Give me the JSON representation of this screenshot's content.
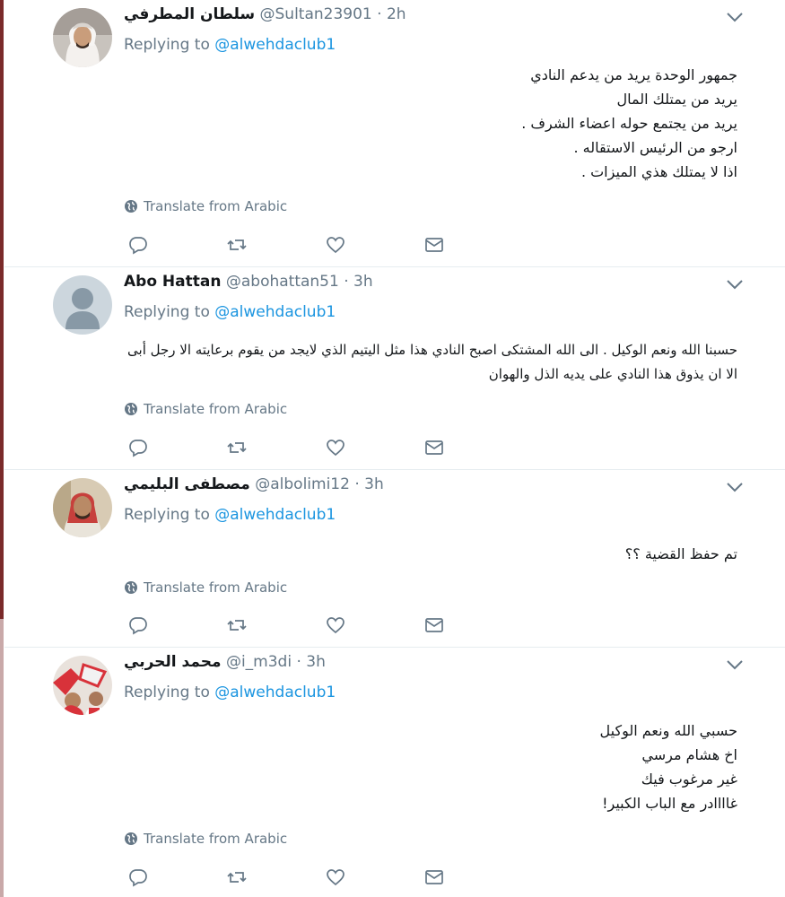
{
  "tweets": [
    {
      "name": "سلطان المطرفي",
      "handle": "@Sultan23901 · 2h",
      "replying_label": "Replying to",
      "replying_to": "@alwehdaclub1",
      "lines": [
        "جمهور الوحدة يريد من يدعم النادي",
        "يريد من يمتلك المال",
        "يريد من يجتمع حوله اعضاء الشرف .",
        "ارجو من الرئيس الاستقاله .",
        "اذا لا يمتلك هذي الميزات ."
      ],
      "translate": "Translate from Arabic"
    },
    {
      "name": "Abo Hattan",
      "handle": "@abohattan51 · 3h",
      "replying_label": "Replying to",
      "replying_to": "@alwehdaclub1",
      "lines": [
        "حسبنا الله ونعم الوكيل . الى الله المشتكى اصبح النادي هذا مثل اليتيم الذي لايجد من يقوم برعايته الا رجل أبى",
        "الا ان يذوق هذا النادي على يديه الذل والهوان"
      ],
      "translate": "Translate from Arabic"
    },
    {
      "name": "مصطفى البليمي",
      "handle": "@albolimi12 · 3h",
      "replying_label": "Replying to",
      "replying_to": "@alwehdaclub1",
      "lines": [
        "تم حفظ القضية ؟؟"
      ],
      "translate": "Translate from Arabic"
    },
    {
      "name": "محمد الحربي",
      "handle": "@i_m3di · 3h",
      "replying_label": "Replying to",
      "replying_to": "@alwehdaclub1",
      "lines": [
        "حسبي الله ونعم الوكيل",
        "اخ هشام مرسي",
        "غير مرغوب فيك",
        "غاااادر مع الباب الكبير!"
      ],
      "translate": "Translate from Arabic"
    }
  ],
  "icons": [
    "reply-icon",
    "retweet-icon",
    "like-icon",
    "direct-message-icon",
    "globe-icon",
    "chevron-down-icon"
  ],
  "colors": {
    "link": "#1b95e0",
    "muted": "#657786",
    "divider": "#e6ecf0"
  }
}
